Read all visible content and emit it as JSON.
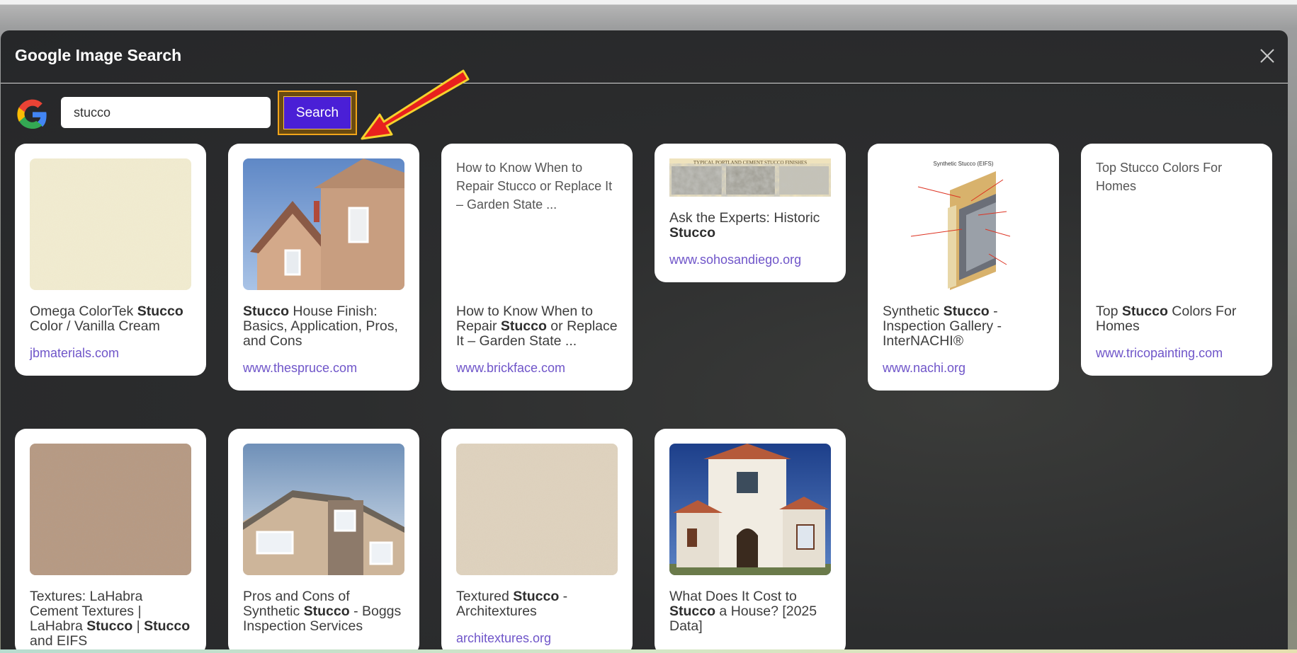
{
  "modal": {
    "title": "Google Image Search",
    "close_icon": "close-icon"
  },
  "search": {
    "logo_icon": "google-g-icon",
    "query": "stucco",
    "button_label": "Search",
    "highlight_color": "#f2a51a",
    "arrow_icon": "red-arrow-icon"
  },
  "colors": {
    "modal_bg": "#2c2d2e",
    "button": "#4a1fd6",
    "link": "#6f55c9"
  },
  "results": [
    {
      "title_parts": [
        "Omega ColorTek ",
        "Stucco",
        " Color / Vanilla Cream"
      ],
      "source": "jbmaterials.com",
      "image": "cream stucco texture"
    },
    {
      "title_parts": [
        "",
        "Stucco",
        " House Finish: Basics, Application, Pros, and Cons"
      ],
      "source": "www.thespruce.com",
      "image": "tan stucco house"
    },
    {
      "title_parts": [
        "How to Know When to Repair ",
        "Stucco",
        " or Replace It – Garden State ..."
      ],
      "source": "www.brickface.com",
      "image_alt": "How to Know When to Repair Stucco or Replace It – Garden State ..."
    },
    {
      "title_parts": [
        "Ask the Experts: Historic ",
        "Stucco",
        ""
      ],
      "source": "www.sohosandiego.org",
      "image": "TYPICAL PORTLAND CEMENT STUCCO FINISHES"
    },
    {
      "title_parts": [
        "Synthetic ",
        "Stucco",
        " - Inspection Gallery - InterNACHI®"
      ],
      "source": "www.nachi.org",
      "image": "Synthetic Stucco (EIFS)"
    },
    {
      "title_parts": [
        "Top ",
        "Stucco",
        " Colors For Homes"
      ],
      "source": "www.tricopainting.com",
      "image_alt": "Top Stucco Colors For Homes"
    },
    {
      "title_parts": [
        "Textures: LaHabra Cement Textures | LaHabra ",
        "Stucco",
        " | "
      ],
      "title_tail_bold": "Stucco",
      "title_tail": " and EIFS",
      "source": "",
      "image": "brown stucco texture"
    },
    {
      "title_parts": [
        "Pros and Cons of Synthetic ",
        "Stucco",
        " - Boggs Inspection Services"
      ],
      "source": "",
      "image": "stone and stucco house"
    },
    {
      "title_parts": [
        "Textured ",
        "Stucco",
        " - Architextures"
      ],
      "source": "architextures.org",
      "image": "beige stucco texture"
    },
    {
      "title_parts": [
        "What Does It Cost to ",
        "Stucco",
        " a House? [2025 Data]"
      ],
      "source": "",
      "image": "white stucco villa"
    }
  ]
}
